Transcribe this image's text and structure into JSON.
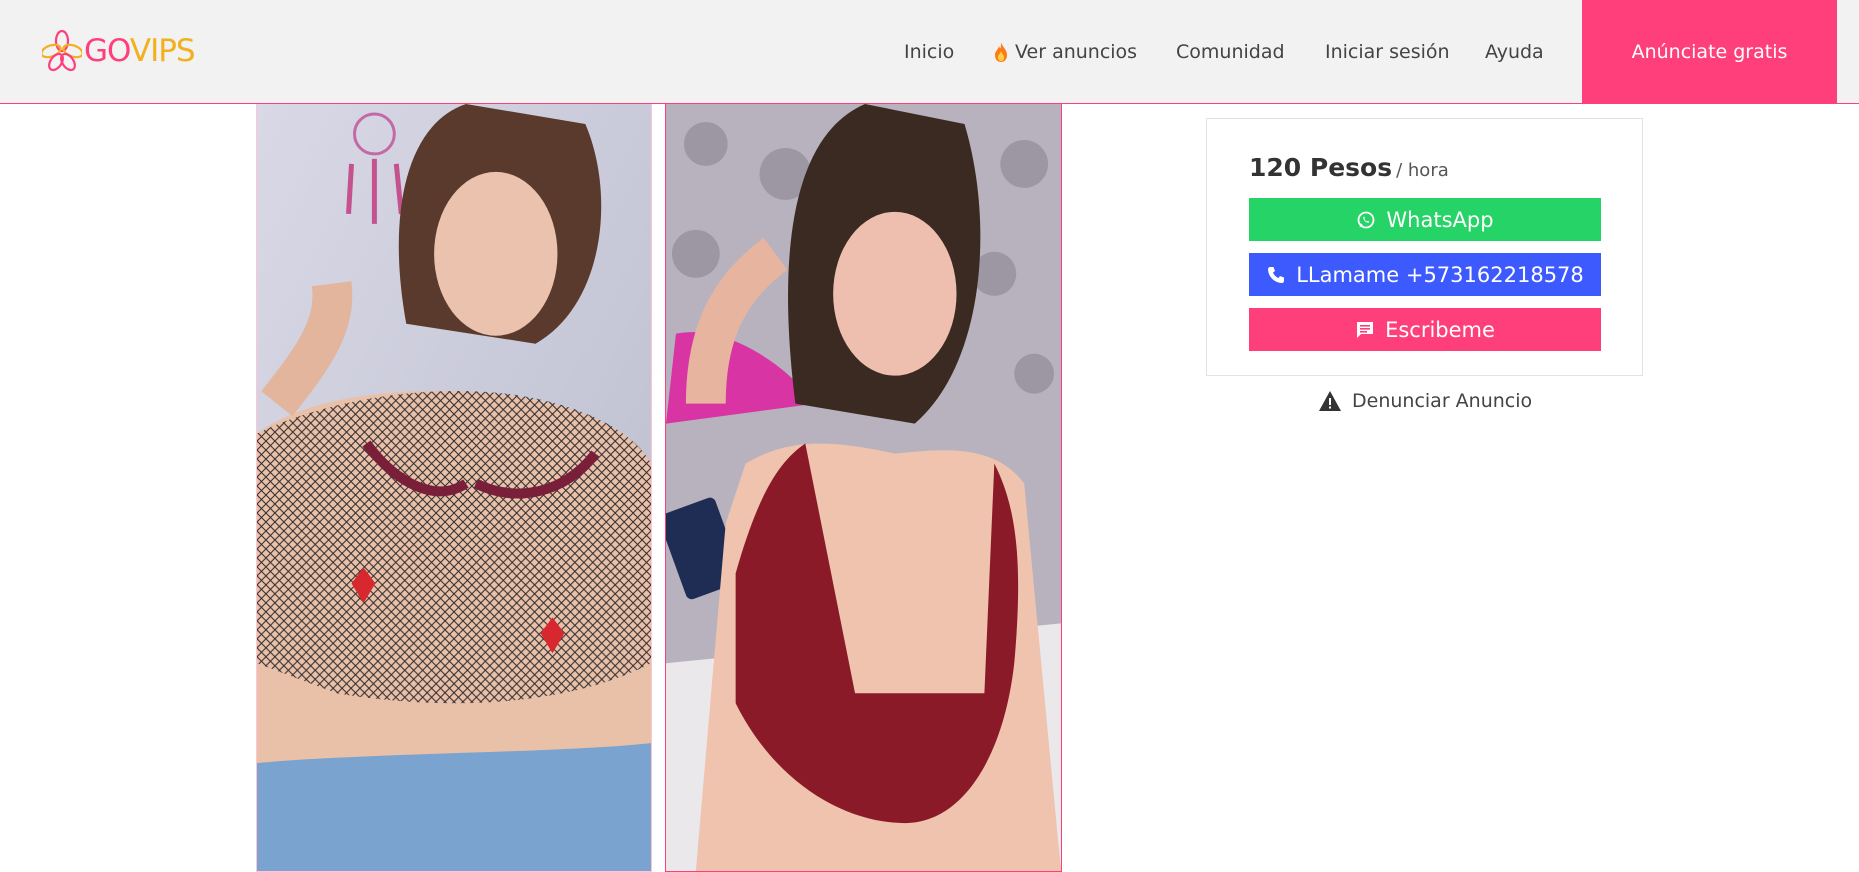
{
  "header": {
    "logo_text_part1": "GO",
    "logo_text_part2": "VIPS",
    "nav": [
      "Inicio",
      "Ver anuncios",
      "Comunidad",
      "Iniciar sesión",
      "Ayuda"
    ],
    "cta_label": "Anúnciate gratis"
  },
  "listing": {
    "price_amount": "120 Pesos",
    "price_unit": "/ hora",
    "whatsapp_label": "WhatsApp",
    "call_label": "LLamame +573162218578",
    "message_label": "Escribeme",
    "report_label": "Denunciar Anuncio"
  },
  "colors": {
    "brand_pink": "#ff3f7c",
    "brand_gold": "#f2b01e",
    "whatsapp_green": "#25d366",
    "call_blue": "#3d5afe"
  }
}
